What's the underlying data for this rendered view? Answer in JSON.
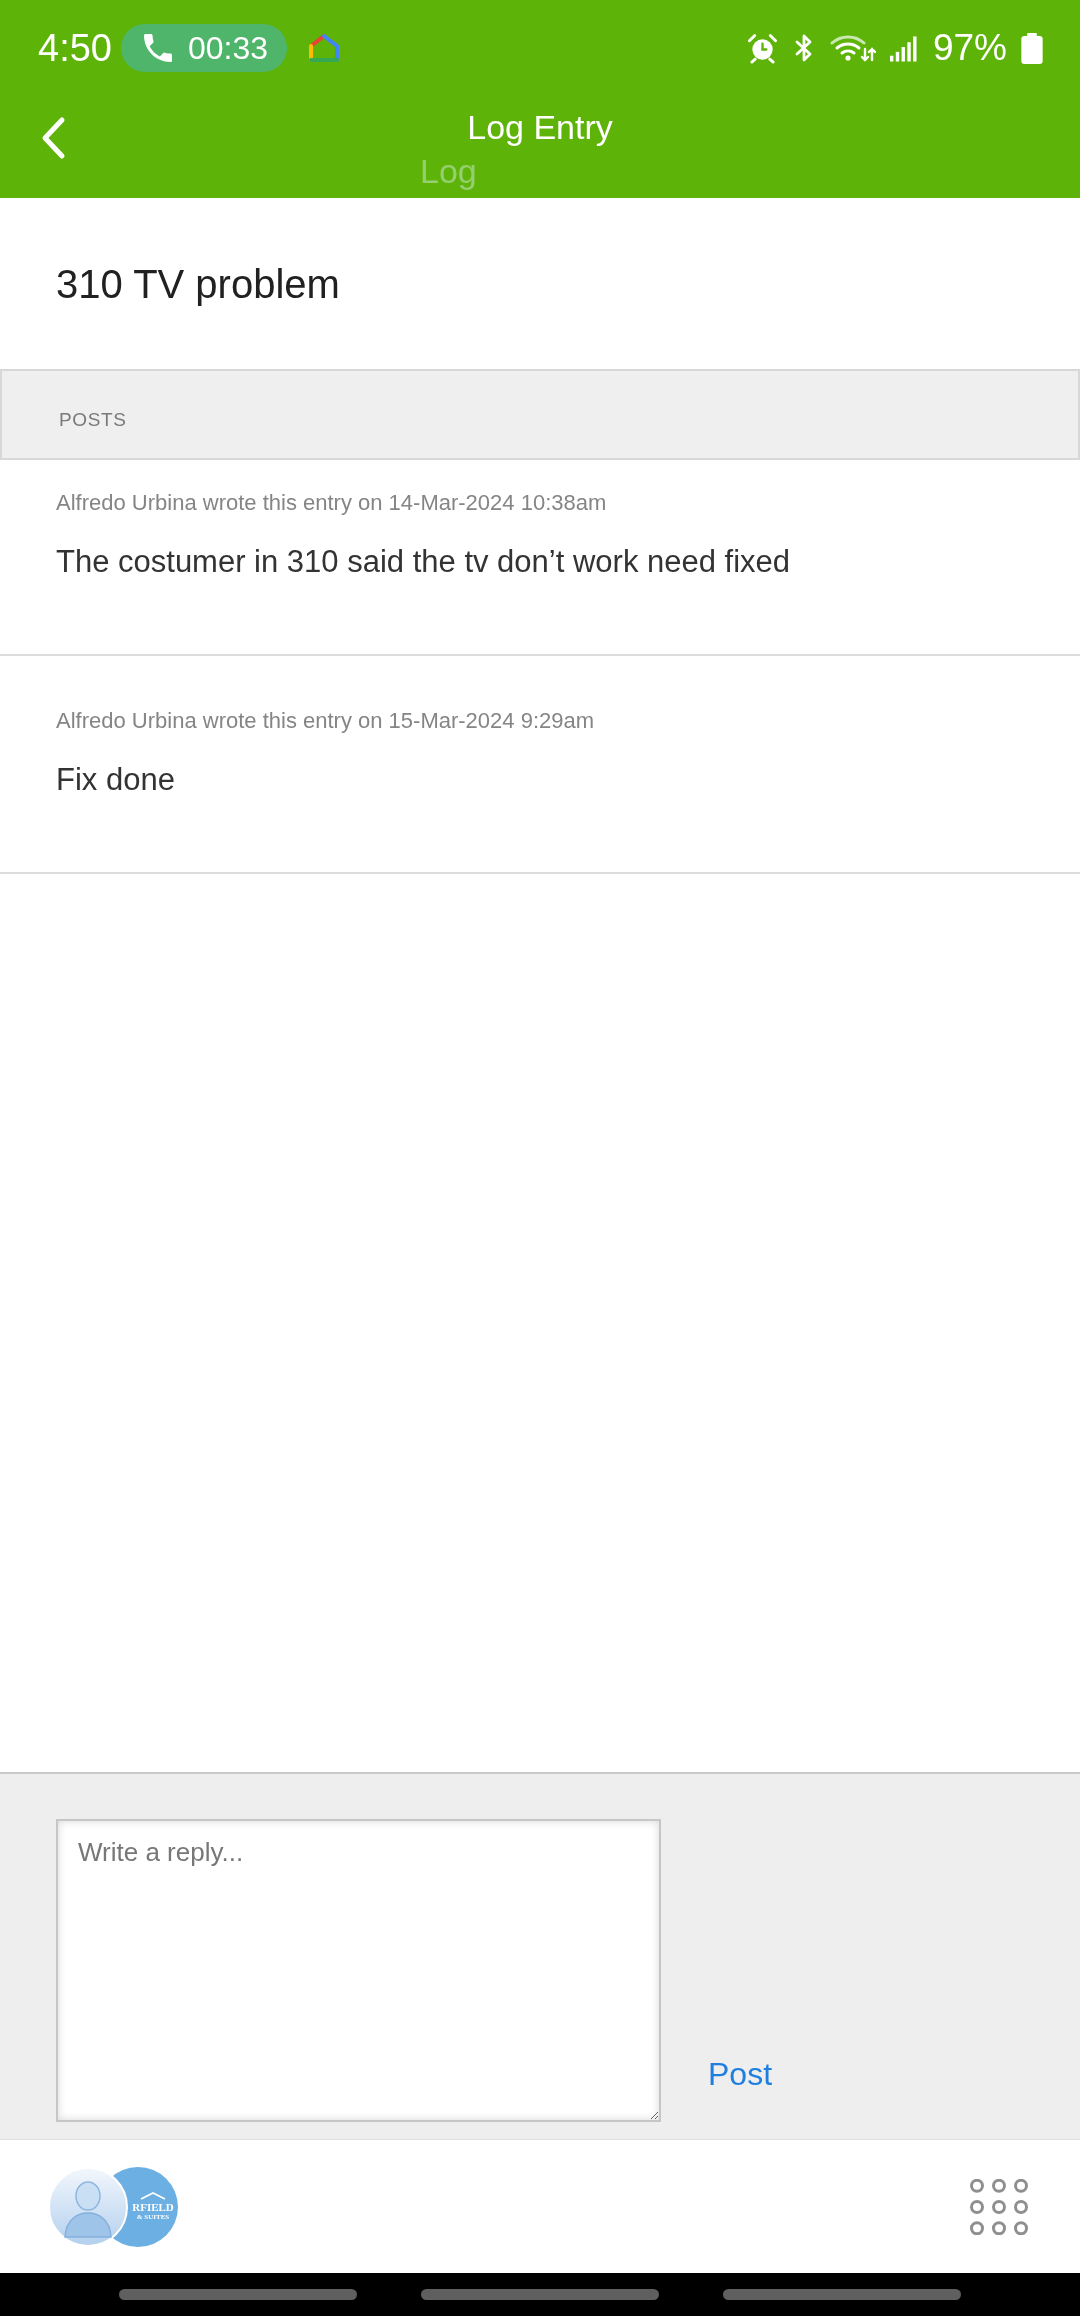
{
  "status_bar": {
    "time": "4:50",
    "call_timer": "00:33",
    "battery": "97%"
  },
  "header": {
    "title": "Log Entry",
    "faded_title": "Log"
  },
  "entry": {
    "title": "310 TV problem"
  },
  "posts": {
    "heading": "POSTS",
    "items": [
      {
        "meta": "Alfredo Urbina wrote this entry on 14-Mar-2024 10:38am",
        "body": "The costumer in 310 said the tv don’t work need fixed"
      },
      {
        "meta": "Alfredo Urbina wrote this entry on 15-Mar-2024 9:29am",
        "body": "Fix done"
      }
    ]
  },
  "reply": {
    "placeholder": "Write a reply...",
    "post_button": "Post"
  },
  "footer": {
    "logo_lines": [
      "RFIELD",
      "& SUITES"
    ]
  }
}
